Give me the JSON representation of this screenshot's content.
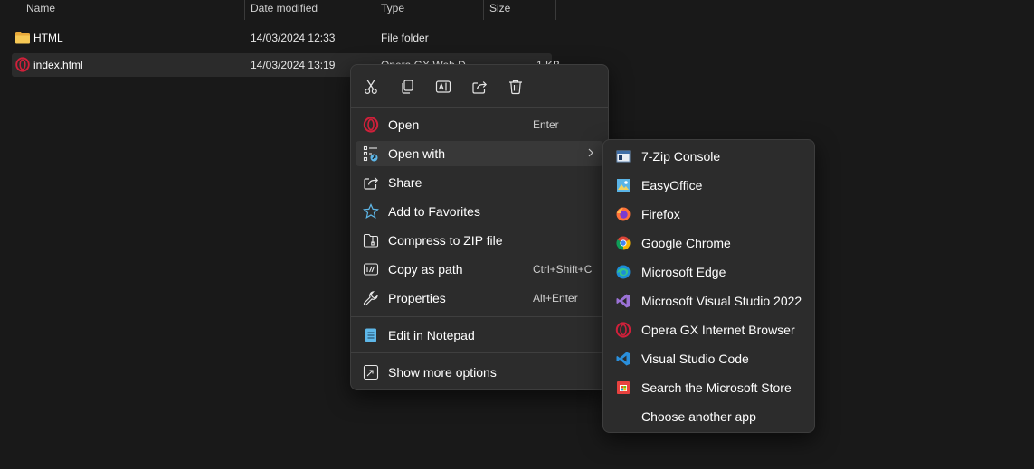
{
  "columns": {
    "name": "Name",
    "date_modified": "Date modified",
    "type": "Type",
    "size": "Size"
  },
  "files": [
    {
      "name": "HTML",
      "date": "14/03/2024 12:33",
      "type": "File folder",
      "size": ""
    },
    {
      "name": "index.html",
      "date": "14/03/2024 13:19",
      "type": "Opera GX Web D...",
      "size": "1 KB"
    }
  ],
  "quick_actions": [
    "cut",
    "copy",
    "rename",
    "share",
    "delete"
  ],
  "context_menu": {
    "open": {
      "label": "Open",
      "shortcut": "Enter"
    },
    "open_with": {
      "label": "Open with"
    },
    "share": {
      "label": "Share"
    },
    "add_to_favorites": {
      "label": "Add to Favorites"
    },
    "compress": {
      "label": "Compress to ZIP file"
    },
    "copy_as_path": {
      "label": "Copy as path",
      "shortcut": "Ctrl+Shift+C"
    },
    "properties": {
      "label": "Properties",
      "shortcut": "Alt+Enter"
    },
    "edit_notepad": {
      "label": "Edit in Notepad"
    },
    "show_more": {
      "label": "Show more options"
    }
  },
  "open_with_menu": [
    {
      "label": "7-Zip Console",
      "icon": "7zip-console-icon"
    },
    {
      "label": "EasyOffice",
      "icon": "easyoffice-icon"
    },
    {
      "label": "Firefox",
      "icon": "firefox-icon"
    },
    {
      "label": "Google Chrome",
      "icon": "chrome-icon"
    },
    {
      "label": "Microsoft Edge",
      "icon": "edge-icon"
    },
    {
      "label": "Microsoft Visual Studio 2022",
      "icon": "visual-studio-icon"
    },
    {
      "label": "Opera GX Internet Browser",
      "icon": "opera-gx-icon"
    },
    {
      "label": "Visual Studio Code",
      "icon": "vscode-icon"
    },
    {
      "label": "Search the Microsoft Store",
      "icon": "ms-store-icon"
    },
    {
      "label": "Choose another app",
      "icon": ""
    }
  ],
  "colors": {
    "background": "#191919",
    "menu_bg": "#2c2c2c",
    "hover": "#383838",
    "opera_red": "#d0203a",
    "folder_yellow": "#f3c24d",
    "accent_blue": "#5eb7e8"
  }
}
